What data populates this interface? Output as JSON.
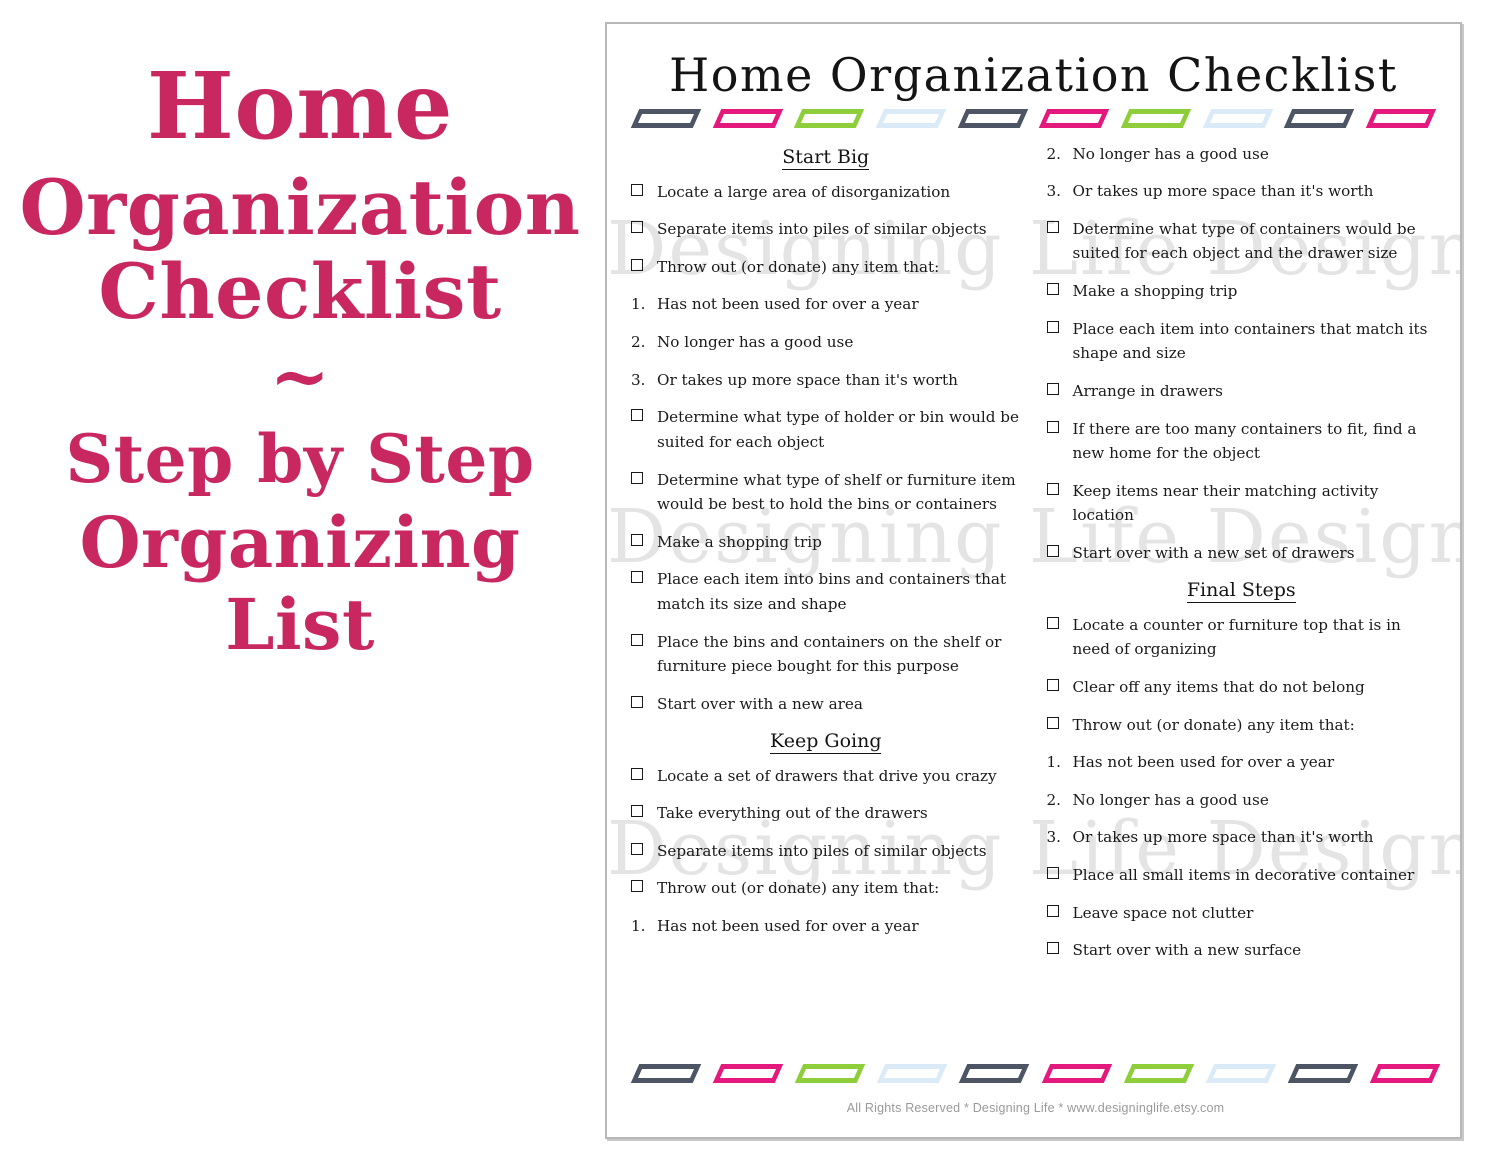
{
  "promo": {
    "line1": "Home",
    "line2": "Organization",
    "line3": "Checklist",
    "tilde": "~",
    "line4": "Step by Step",
    "line5": "Organizing",
    "line6": "List",
    "accent_color": "#c9275f"
  },
  "document": {
    "title": "Home Organization Checklist",
    "watermark": "Designing Life Designs",
    "footer": "All Rights Reserved * Designing Life * www.designinglife.etsy.com",
    "deco_colors": [
      "#4d5463",
      "#e3197d",
      "#8ece3a",
      "#dbeaf7",
      "#4d5463",
      "#e3197d",
      "#8ece3a",
      "#dbeaf7",
      "#4d5463",
      "#e3197d"
    ]
  },
  "left_column": {
    "section_title": "Start Big",
    "items": [
      {
        "marker": "checkbox",
        "text": "Locate a large area of disorganization"
      },
      {
        "marker": "checkbox",
        "text": "Separate items into piles of similar objects"
      },
      {
        "marker": "checkbox",
        "text": "Throw out (or donate) any item that:"
      },
      {
        "marker": "1.",
        "text": "Has not been used for over a year"
      },
      {
        "marker": "2.",
        "text": "No longer has a good use"
      },
      {
        "marker": "3.",
        "text": "Or takes up more space than it's worth"
      },
      {
        "marker": "checkbox",
        "text": "Determine what type of holder or bin would be suited for each object"
      },
      {
        "marker": "checkbox",
        "text": "Determine what type of shelf or furniture item would be best to hold the bins or containers"
      },
      {
        "marker": "checkbox",
        "text": "Make a shopping trip"
      },
      {
        "marker": "checkbox",
        "text": "Place each item into bins and containers that match its size and shape"
      },
      {
        "marker": "checkbox",
        "text": "Place the bins and containers on the shelf or furniture piece bought for this purpose"
      },
      {
        "marker": "checkbox",
        "text": "Start over with a new area"
      }
    ],
    "section_title_2": "Keep Going",
    "items_2": [
      {
        "marker": "checkbox",
        "text": "Locate a set of drawers that drive you crazy"
      },
      {
        "marker": "checkbox",
        "text": "Take everything out of the drawers"
      },
      {
        "marker": "checkbox",
        "text": "Separate items into piles of similar objects"
      },
      {
        "marker": "checkbox",
        "text": "Throw out (or donate) any item that:"
      },
      {
        "marker": "1.",
        "text": "Has not been used for over a year"
      }
    ]
  },
  "right_column": {
    "items": [
      {
        "marker": "2.",
        "text": "No longer has a good use"
      },
      {
        "marker": "3.",
        "text": "Or takes up more space than it's worth"
      },
      {
        "marker": "checkbox",
        "text": "Determine what type of containers would be suited for each object and the drawer size"
      },
      {
        "marker": "checkbox",
        "text": "Make a shopping trip"
      },
      {
        "marker": "checkbox",
        "text": "Place each item into containers that match its shape and size"
      },
      {
        "marker": "checkbox",
        "text": "Arrange in drawers"
      },
      {
        "marker": "checkbox",
        "text": "If there are too many containers to fit, find a new home for the object"
      },
      {
        "marker": "checkbox",
        "text": "Keep items near their matching activity location"
      },
      {
        "marker": "checkbox",
        "text": "Start over with a new set of drawers"
      }
    ],
    "section_title_2": "Final Steps",
    "items_2": [
      {
        "marker": "checkbox",
        "text": "Locate a counter or furniture top that is in need of organizing"
      },
      {
        "marker": "checkbox",
        "text": "Clear off any items that do not belong"
      },
      {
        "marker": "checkbox",
        "text": "Throw out (or donate) any item that:"
      },
      {
        "marker": "1.",
        "text": "Has not been used for over a year"
      },
      {
        "marker": "2.",
        "text": "No longer has a good use"
      },
      {
        "marker": "3.",
        "text": "Or takes up more space than it's worth"
      },
      {
        "marker": "checkbox",
        "text": "Place all small items in decorative container"
      },
      {
        "marker": "checkbox",
        "text": "Leave space not clutter"
      },
      {
        "marker": "checkbox",
        "text": "Start over with a new surface"
      }
    ]
  }
}
